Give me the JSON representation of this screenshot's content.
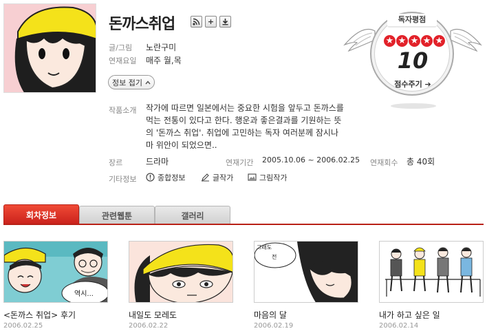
{
  "header": {
    "title": "돈까스취업",
    "icons": [
      "rss-icon",
      "plus-icon",
      "download-icon"
    ]
  },
  "info": {
    "author_label": "글/그림",
    "author": "노란구미",
    "days_label": "연재요일",
    "days": "매주 월,목",
    "toggle_label": "정보 접기",
    "synopsis_label": "작품소개",
    "synopsis": "작가에 따르면 일본에서는 중요한 시험을 앞두고 돈까스를 먹는 전통이 있다고 한다. 행운과 좋은결과를 기원하는 뜻의 '돈까스 취업'. 취업에 고민하는 독자 여러분께 잠시나마 위안이 되었으면..",
    "genre_label": "장르",
    "genre": "드라마",
    "period_label": "연재기간",
    "period": "2005.10.06 ~ 2006.02.25",
    "count_label": "연재회수",
    "count": "총 40회",
    "etc_label": "기타정보",
    "etc_links": [
      "종합정보",
      "글작가",
      "그림작가"
    ]
  },
  "rating": {
    "title": "독자평점",
    "stars": 5,
    "score": "10",
    "rate_label": "점수주기",
    "colors": {
      "star": "#e2222a"
    }
  },
  "tabs": [
    {
      "label": "회차정보",
      "active": true
    },
    {
      "label": "관련웹툰",
      "active": false
    },
    {
      "label": "갤러리",
      "active": false
    }
  ],
  "episodes": [
    {
      "title": "<돈까스 취업> 후기",
      "date": "2006.02.25",
      "bubble": "역시..."
    },
    {
      "title": "내일도 모레도",
      "date": "2006.02.22",
      "bubble": ""
    },
    {
      "title": "마음의 달",
      "date": "2006.02.19",
      "bubble": "그래도 전"
    },
    {
      "title": "내가 하고 싶은 일",
      "date": "2006.02.14",
      "bubble": ""
    }
  ],
  "colors": {
    "accent": "#d2261c"
  }
}
